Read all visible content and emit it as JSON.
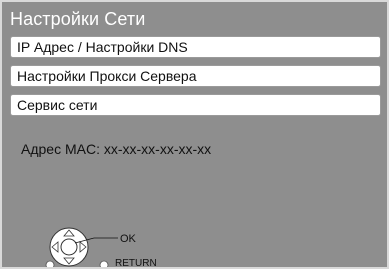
{
  "header": {
    "title": "Настройки Сети"
  },
  "menu": {
    "items": [
      {
        "label": "IP Адрес / Настройки DNS"
      },
      {
        "label": "Настройки Прокси Сервера"
      },
      {
        "label": "Сервис сети"
      }
    ]
  },
  "info": {
    "mac_label": "Адрес MAC:",
    "mac_value": "xx-xx-xx-xx-xx-xx"
  },
  "remote_hints": {
    "ok_label": "OK",
    "return_label": "RETURN",
    "icons": [
      "dpad-icon",
      "return-button-icon"
    ]
  },
  "colors": {
    "background": "#8e8e8e",
    "menu_item_bg": "#ffffff",
    "title_text": "#ffffff"
  }
}
